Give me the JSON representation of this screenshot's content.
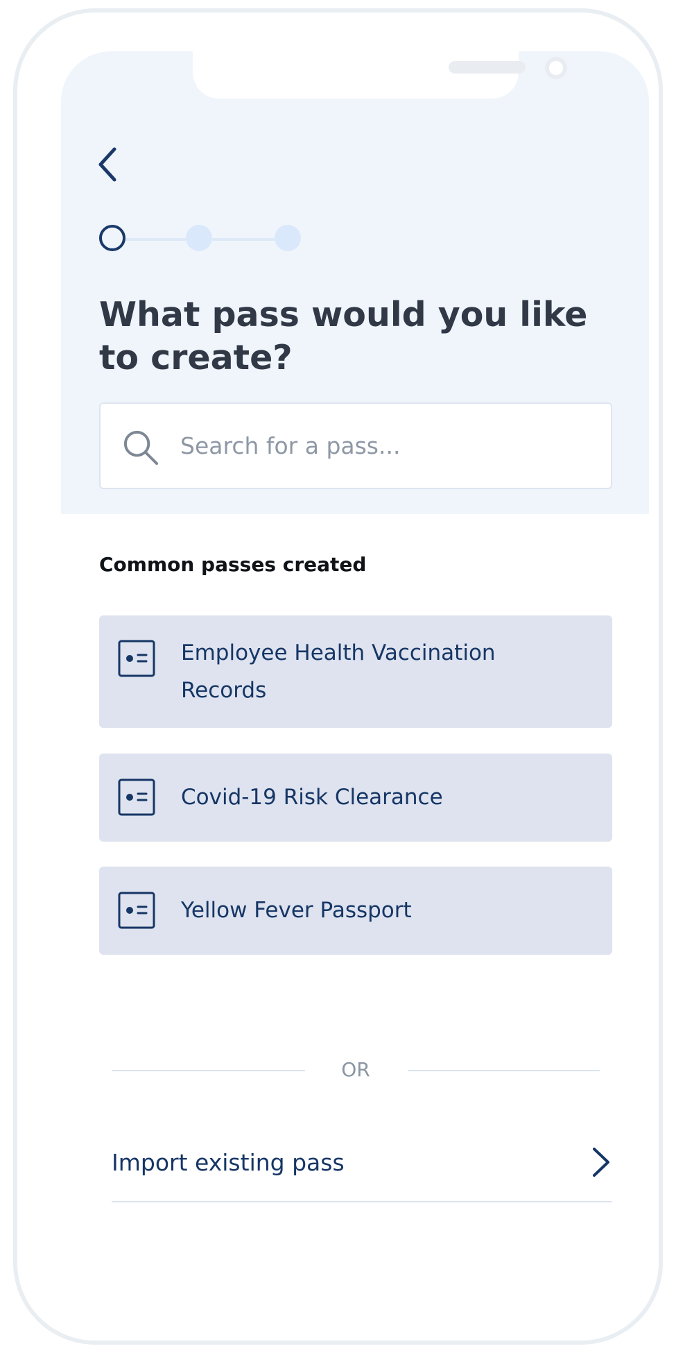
{
  "navigation": {
    "back_icon": "chevron-left-icon"
  },
  "progress": {
    "current_step": 1,
    "total_steps": 3
  },
  "header": {
    "title": "What pass would you like to create?"
  },
  "search": {
    "icon": "search-icon",
    "placeholder": "Search for a pass...",
    "value": ""
  },
  "common_passes": {
    "label": "Common passes created",
    "items": [
      {
        "label": "Employee Health Vaccination Records",
        "icon": "id-card-icon"
      },
      {
        "label": "Covid-19 Risk Clearance",
        "icon": "id-card-icon"
      },
      {
        "label": "Yellow Fever Passport",
        "icon": "id-card-icon"
      }
    ]
  },
  "separator": {
    "label": "OR"
  },
  "import": {
    "label": "Import existing pass",
    "icon": "chevron-right-icon"
  },
  "colors": {
    "primary": "#1a3968",
    "header_background": "#f0f5fc",
    "card_background": "#dee3ef",
    "step_inactive": "#d9e8fa",
    "title_text": "#313846"
  }
}
